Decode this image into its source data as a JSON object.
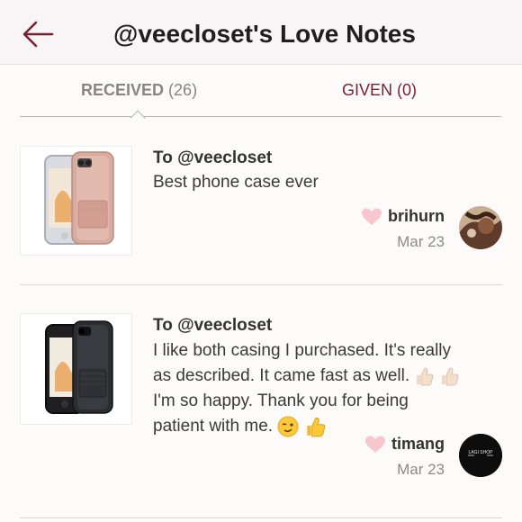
{
  "header": {
    "title": "@veecloset's Love Notes",
    "back_icon": "back-arrow-icon",
    "accent": "#7a1f33"
  },
  "tabs": [
    {
      "label": "RECEIVED",
      "count": "(26)",
      "active": true
    },
    {
      "label": "GIVEN",
      "count": "(0)",
      "active": false
    }
  ],
  "notes": [
    {
      "to": "To @veecloset",
      "message": "Best phone case ever",
      "sender": "brihurn",
      "date": "Mar 23",
      "product": "rose-gold-phone-case",
      "avatar": "brihurn-avatar"
    },
    {
      "to": "To @veecloset",
      "message_lines": [
        "I like both casing I purchased. It's really",
        "as described. It came fast as well.",
        "I'm so happy. Thank you for being",
        "patient with me."
      ],
      "sender": "timang",
      "date": "Mar 23",
      "product": "black-phone-case",
      "avatar": "timang-avatar",
      "avatar_text": "LAGI SHOP"
    }
  ]
}
